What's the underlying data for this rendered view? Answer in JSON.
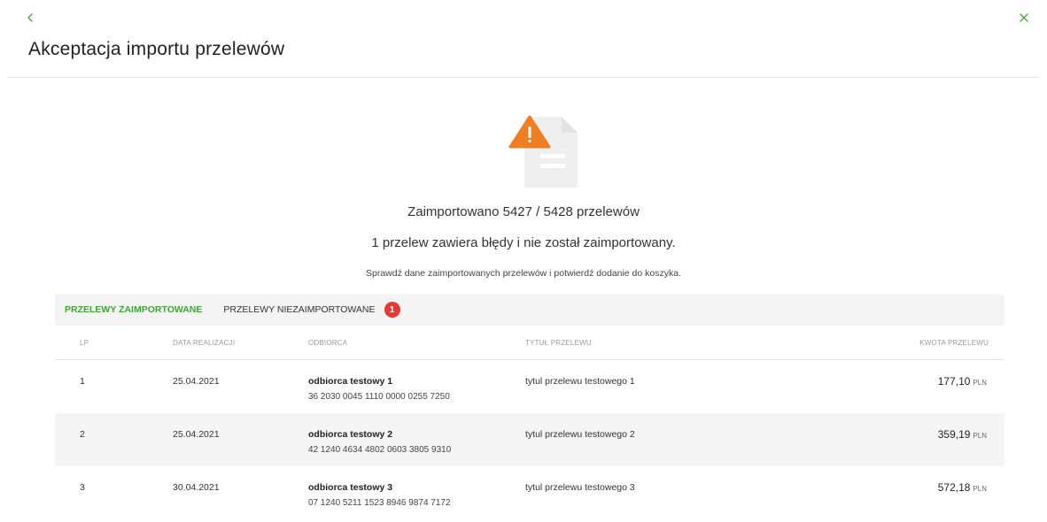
{
  "header": {
    "title": "Akceptacja importu przelewów"
  },
  "summary": {
    "imported": "Zaimportowano 5427 / 5428 przelewów",
    "error": "1 przelew zawiera błędy i nie został zaimportowany.",
    "hint": "Sprawdź dane zaimportowanych przelewów i potwierdź dodanie do koszyka."
  },
  "tabs": [
    {
      "label": "PRZELEWY ZAIMPORTOWANE",
      "active": true
    },
    {
      "label": "PRZELEWY NIEZAIMPORTOWANE",
      "active": false,
      "badge": "1"
    }
  ],
  "table": {
    "columns": [
      "LP",
      "DATA REALIZACJI",
      "ODBIORCA",
      "TYTUŁ PRZELEWU",
      "KWOTA PRZELEWU"
    ],
    "rows": [
      {
        "lp": "1",
        "date": "25.04.2021",
        "name": "odbiorca testowy 1",
        "account": "36 2030 0045 1110 0000 0255 7250",
        "title": "tytul przelewu testowego 1",
        "amount": "177,10",
        "currency": "PLN"
      },
      {
        "lp": "2",
        "date": "25.04.2021",
        "name": "odbiorca testowy 2",
        "account": "42 1240 4634 4802 0603 3805 9310",
        "title": "tytul przelewu testowego 2",
        "amount": "359,19",
        "currency": "PLN"
      },
      {
        "lp": "3",
        "date": "30.04.2021",
        "name": "odbiorca testowy 3",
        "account": "07 1240 5211 1523 8946 9874 7172",
        "title": "tytul przelewu testowego 3",
        "amount": "572,18",
        "currency": "PLN"
      }
    ]
  },
  "colors": {
    "accent": "#3fa534",
    "warning": "#ef7d22",
    "badge": "#e53935"
  },
  "icons": {
    "back": "chevron-left-icon",
    "close": "close-icon",
    "status": "file-warning-icon"
  }
}
